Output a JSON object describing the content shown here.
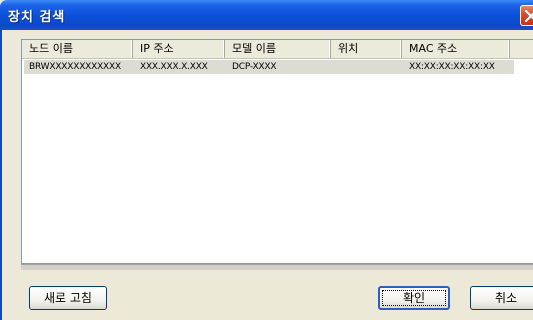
{
  "window": {
    "title": "장치 검색",
    "close_icon": "close-icon"
  },
  "list": {
    "columns": [
      "노드 이름",
      "IP 주소",
      "모델 이름",
      "위치",
      "MAC 주소",
      ""
    ],
    "rows": [
      {
        "node_name": "BRWXXXXXXXXXXXX",
        "ip": "XXX.XXX.X.XXX",
        "model": "DCP-XXXX",
        "location": "",
        "mac": "XX:XX:XX:XX:XX:XX"
      }
    ]
  },
  "buttons": {
    "refresh": "새로 고침",
    "ok": "확인",
    "cancel": "취소"
  }
}
